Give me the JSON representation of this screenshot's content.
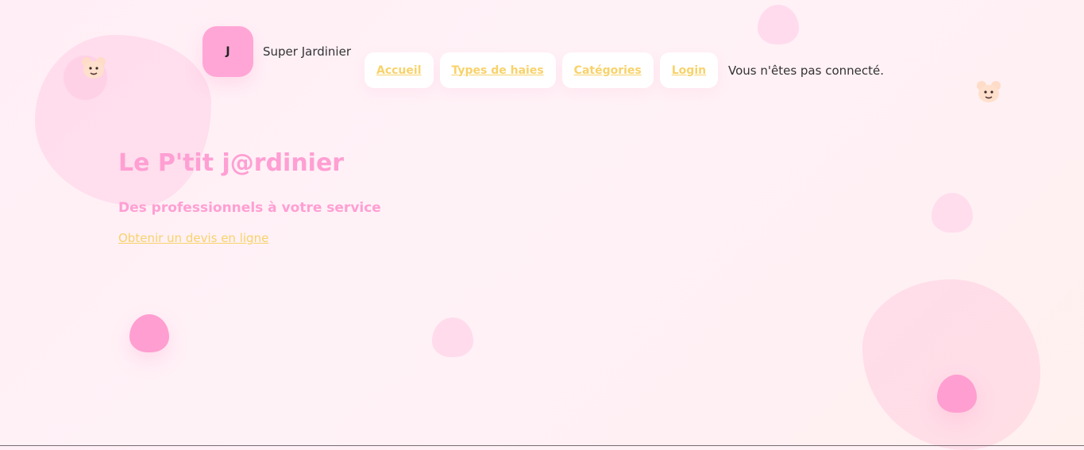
{
  "header": {
    "logo_letter": "J",
    "site_name": "Super Jardinier",
    "nav": [
      {
        "label": "Accueil"
      },
      {
        "label": "Types de haies"
      },
      {
        "label": "Catégories"
      },
      {
        "label": "Login"
      }
    ],
    "login_status": "Vous n'êtes pas connecté."
  },
  "hero": {
    "title": "Le P'tit j@rdinier",
    "subtitle": "Des professionnels à votre service",
    "quote_link": "Obtenir un devis en ligne"
  },
  "colors": {
    "accent_pink": "#ff9fd3",
    "link_yellow": "#f8d26a",
    "logo_pink": "#ffa6d6",
    "background": "#fff0f6"
  },
  "icons": {
    "decoration_left": "bear-icon",
    "decoration_right": "bear-icon"
  }
}
